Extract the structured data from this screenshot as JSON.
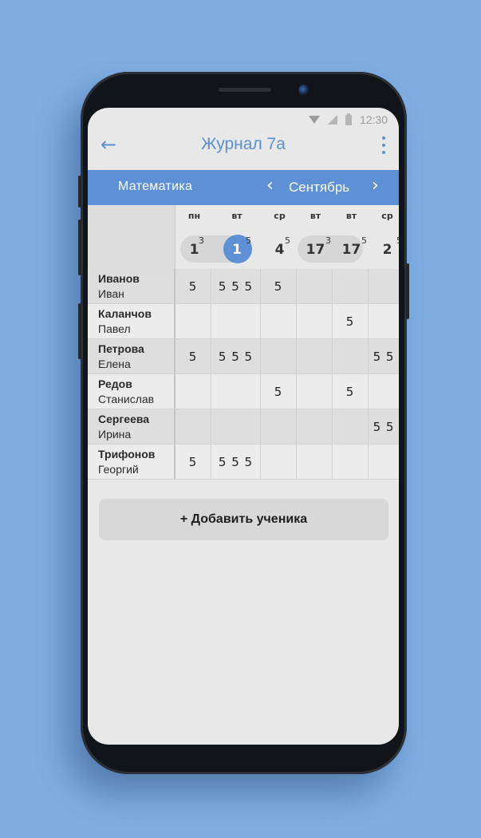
{
  "status_bar": {
    "time": "12:30"
  },
  "app_bar": {
    "title": "Журнал 7а"
  },
  "sub_bar": {
    "subject": "Математика",
    "month": "Сентябрь"
  },
  "columns": [
    {
      "day": "пн",
      "date": "1",
      "lessons": "3"
    },
    {
      "day": "вт",
      "date": "1",
      "lessons": "5",
      "selected": true
    },
    {
      "day": "ср",
      "date": "4",
      "lessons": "5"
    },
    {
      "day": "вт",
      "date": "17",
      "lessons": "3"
    },
    {
      "day": "вт",
      "date": "17",
      "lessons": "5"
    },
    {
      "day": "ср",
      "date": "2",
      "lessons": "5"
    }
  ],
  "students": [
    {
      "surname": "Иванов",
      "name": "Иван",
      "grades": [
        "5",
        "5 5 5",
        "5",
        "",
        "",
        ""
      ]
    },
    {
      "surname": "Каланчов",
      "name": "Павел",
      "grades": [
        "",
        "",
        "",
        "",
        "5",
        ""
      ]
    },
    {
      "surname": "Петрова",
      "name": "Елена",
      "grades": [
        "5",
        "5 5 5",
        "",
        "",
        "",
        "5 5"
      ]
    },
    {
      "surname": "Редов",
      "name": "Станислав",
      "grades": [
        "",
        "",
        "5",
        "",
        "5",
        ""
      ]
    },
    {
      "surname": "Сергеева",
      "name": "Ирина",
      "grades": [
        "",
        "",
        "",
        "",
        "",
        "5 5"
      ]
    },
    {
      "surname": "Трифонов",
      "name": "Георгий",
      "grades": [
        "5",
        "5 5 5",
        "",
        "",
        "",
        ""
      ]
    }
  ],
  "add_button": {
    "label": "+ Добавить ученика"
  },
  "colors": {
    "accent": "#5d90d4",
    "background": "#7eaee2"
  }
}
